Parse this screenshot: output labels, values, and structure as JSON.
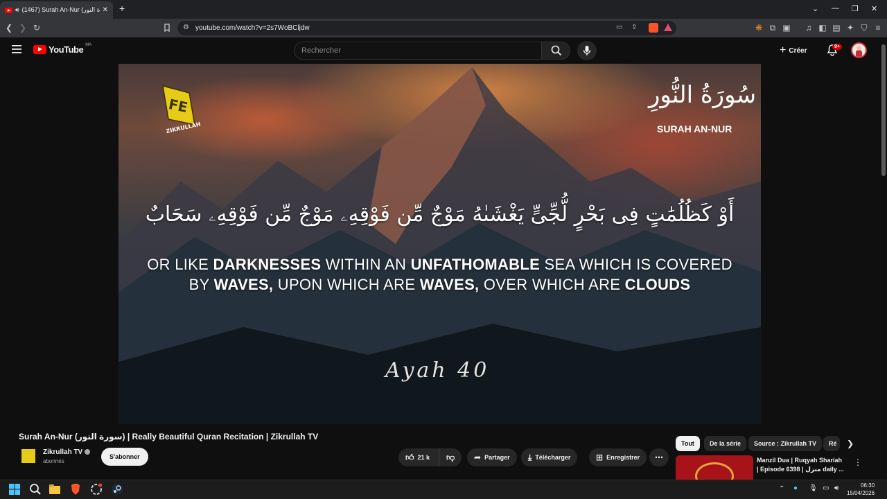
{
  "browser": {
    "tab_title": "(1467) Surah An-Nur (سورة النور)",
    "url": "youtube.com/watch?v=2s7WoBCljdw"
  },
  "header": {
    "logo_text": "YouTube",
    "country": "MA",
    "search_placeholder": "Rechercher",
    "create_label": "Créer",
    "notif_count": "9+"
  },
  "video": {
    "surah_arabic": "سُورَةُ النُّورِ",
    "surah_english": "SURAH AN-NUR",
    "arabic_text": "أَوْ كَظُلُمَٰتٍ فِى بَحْرٍ لُّجِّىٍّ يَغْشَىٰهُ مَوْجٌ مِّن فَوْقِهِۦ مَوْجٌ مِّن فَوْقِهِۦ سَحَابٌ",
    "english_line1": {
      "a": "OR LIKE ",
      "b": "DARKNESSES",
      "c": " WITHIN AN ",
      "d": "UNFATHOMABLE",
      "e": " SEA WHICH IS COVERED"
    },
    "english_line2": {
      "a": "BY ",
      "b": "WAVES,",
      "c": " UPON WHICH ARE ",
      "d": "WAVES,",
      "e": " OVER WHICH ARE ",
      "f": "CLOUDS"
    },
    "ayah_label": "Ayah 40",
    "logo_text": "ZIKRULLAH"
  },
  "details": {
    "title": "Surah An-Nur (سورة النور) | Really Beautiful Quran Recitation | Zikrullah TV",
    "channel_name": "Zikrullah TV",
    "channel_subs": "abonnés",
    "subscribe_label": "S'abonner",
    "like_count": "21 k",
    "share_label": "Partager",
    "download_label": "Télécharger",
    "save_label": "Enregistrer"
  },
  "chips": [
    "Tout",
    "De la série",
    "Source : Zikrullah TV",
    "Ré"
  ],
  "recommendation": {
    "title": "Manzil Dua | Ruqyah Shariah | Episode 6398 | منزل daily ..."
  },
  "taskbar": {
    "time": "06:30",
    "date": "15/04/2026"
  }
}
